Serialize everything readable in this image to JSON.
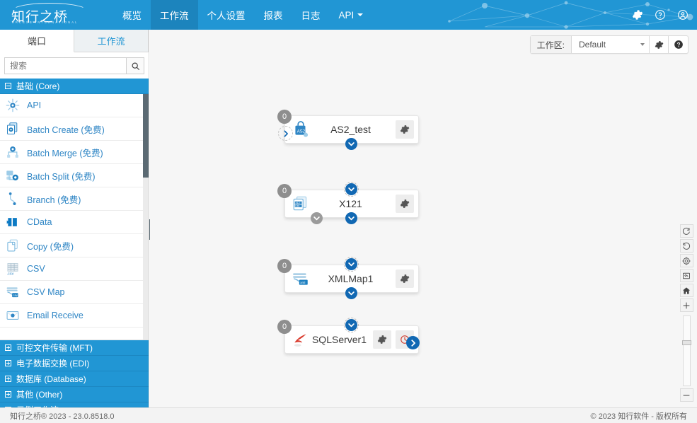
{
  "header": {
    "logo_text": "知行之桥",
    "logo_subtitle": "ARCESB  INTERNATIONAL",
    "nav": [
      {
        "label": "概览",
        "active": false,
        "caret": false
      },
      {
        "label": "工作流",
        "active": true,
        "caret": false
      },
      {
        "label": "个人设置",
        "active": false,
        "caret": false
      },
      {
        "label": "报表",
        "active": false,
        "caret": false
      },
      {
        "label": "日志",
        "active": false,
        "caret": false
      },
      {
        "label": "API",
        "active": false,
        "caret": true
      }
    ],
    "icons": [
      "gear-icon",
      "help-circle-icon",
      "user-circle-icon"
    ],
    "background_color": "#2196d4",
    "active_tab_color": "#1c84bd"
  },
  "sidebar": {
    "tabs": [
      {
        "label": "端口",
        "active": true
      },
      {
        "label": "工作流",
        "active": false
      }
    ],
    "search": {
      "value": "",
      "placeholder": "搜索",
      "button_icon": "search-icon"
    },
    "core_category": {
      "label": "基础 (Core)",
      "expanded": true,
      "toggle": "minus-box-icon"
    },
    "ports": [
      {
        "label": "API",
        "icon": "api-gear-icon"
      },
      {
        "label": "Batch Create (免费)",
        "icon": "batch-create-icon"
      },
      {
        "label": "Batch Merge (免费)",
        "icon": "batch-merge-icon"
      },
      {
        "label": "Batch Split (免费)",
        "icon": "batch-split-icon"
      },
      {
        "label": "Branch (免费)",
        "icon": "branch-icon"
      },
      {
        "label": "CData",
        "icon": "cdata-icon"
      },
      {
        "label": "Copy (免费)",
        "icon": "copy-icon"
      },
      {
        "label": "CSV",
        "icon": "csv-icon"
      },
      {
        "label": "CSV Map",
        "icon": "csv-map-icon"
      },
      {
        "label": "Email Receive",
        "icon": "email-receive-icon"
      }
    ],
    "categories": [
      {
        "label": "可控文件传输 (MFT)",
        "expanded": false
      },
      {
        "label": "电子数据交换 (EDI)",
        "expanded": false
      },
      {
        "label": "数据库 (Database)",
        "expanded": false
      },
      {
        "label": "其他 (Other)",
        "expanded": false
      },
      {
        "label": "示例工作流",
        "expanded": false
      }
    ],
    "collapse_handle": "chevron-left-icon"
  },
  "workspace_bar": {
    "label": "工作区:",
    "selected": "Default",
    "settings_icon": "gear-icon",
    "help_icon": "help-circle-icon"
  },
  "flow": {
    "nodes": [
      {
        "name": "AS2_test",
        "badge": "0",
        "icon": "as2-icon",
        "actions": [
          "gear-icon"
        ],
        "input_arrow": true,
        "output_arrow": false,
        "top_connector": "none",
        "bottom_connector": "blue",
        "bottom_extra": "none"
      },
      {
        "name": "X121",
        "badge": "0",
        "icon": "x12-icon",
        "actions": [
          "gear-icon"
        ],
        "input_arrow": false,
        "output_arrow": false,
        "top_connector": "dashed-blue",
        "bottom_connector": "blue",
        "bottom_extra": "gray"
      },
      {
        "name": "XMLMap1",
        "badge": "0",
        "icon": "xmlmap-icon",
        "actions": [
          "gear-icon"
        ],
        "input_arrow": false,
        "output_arrow": false,
        "top_connector": "dashed-blue",
        "bottom_connector": "blue",
        "bottom_extra": "none"
      },
      {
        "name": "SQLServer1",
        "badge": "0",
        "icon": "sqlserver-icon",
        "actions": [
          "gear-icon",
          "clock-icon"
        ],
        "input_arrow": false,
        "output_arrow": true,
        "top_connector": "dashed-blue",
        "bottom_connector": "none",
        "bottom_extra": "none"
      }
    ]
  },
  "canvas_tools": [
    {
      "name": "redo-icon"
    },
    {
      "name": "undo-icon"
    },
    {
      "name": "target-icon"
    },
    {
      "name": "fit-screen-icon"
    },
    {
      "name": "home-icon"
    },
    {
      "name": "zoom-in-icon"
    },
    {
      "name": "zoom-out-icon"
    }
  ],
  "footer": {
    "left": "知行之桥® 2023 - 23.0.8518.0",
    "right": "© 2023 知行软件 - 版权所有"
  }
}
